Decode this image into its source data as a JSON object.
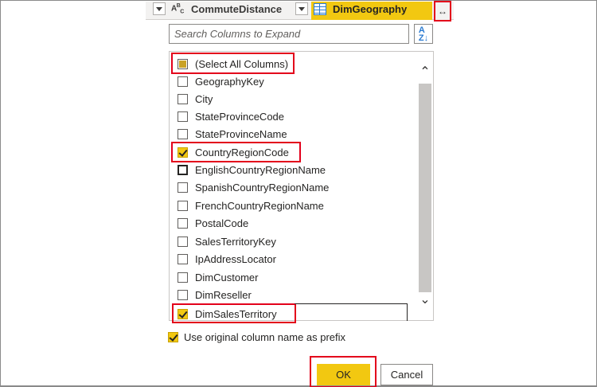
{
  "header": {
    "column1_type_icon": "abc-text-type-icon",
    "column1_name": "CommuteDistance",
    "column2_type_icon": "table-icon",
    "column2_name": "DimGeography",
    "expand_icon": "expand-arrows-icon",
    "accent_color": "#f2c811"
  },
  "search": {
    "placeholder": "Search Columns to Expand",
    "sort_icon": "sort-az-icon"
  },
  "columns": [
    {
      "label": "(Select All Columns)",
      "state": "partial"
    },
    {
      "label": "GeographyKey",
      "state": "unchecked"
    },
    {
      "label": "City",
      "state": "unchecked"
    },
    {
      "label": "StateProvinceCode",
      "state": "unchecked"
    },
    {
      "label": "StateProvinceName",
      "state": "unchecked"
    },
    {
      "label": "CountryRegionCode",
      "state": "checked"
    },
    {
      "label": "EnglishCountryRegionName",
      "state": "unchecked"
    },
    {
      "label": "SpanishCountryRegionName",
      "state": "unchecked"
    },
    {
      "label": "FrenchCountryRegionName",
      "state": "unchecked"
    },
    {
      "label": "PostalCode",
      "state": "unchecked"
    },
    {
      "label": "SalesTerritoryKey",
      "state": "unchecked"
    },
    {
      "label": "IpAddressLocator",
      "state": "unchecked"
    },
    {
      "label": "DimCustomer",
      "state": "unchecked"
    },
    {
      "label": "DimReseller",
      "state": "unchecked"
    },
    {
      "label": "DimSalesTerritory",
      "state": "checked"
    }
  ],
  "prefix_option": {
    "label": "Use original column name as prefix",
    "checked": true
  },
  "buttons": {
    "ok_label": "OK",
    "cancel_label": "Cancel"
  },
  "highlight_color": "#e3001b"
}
